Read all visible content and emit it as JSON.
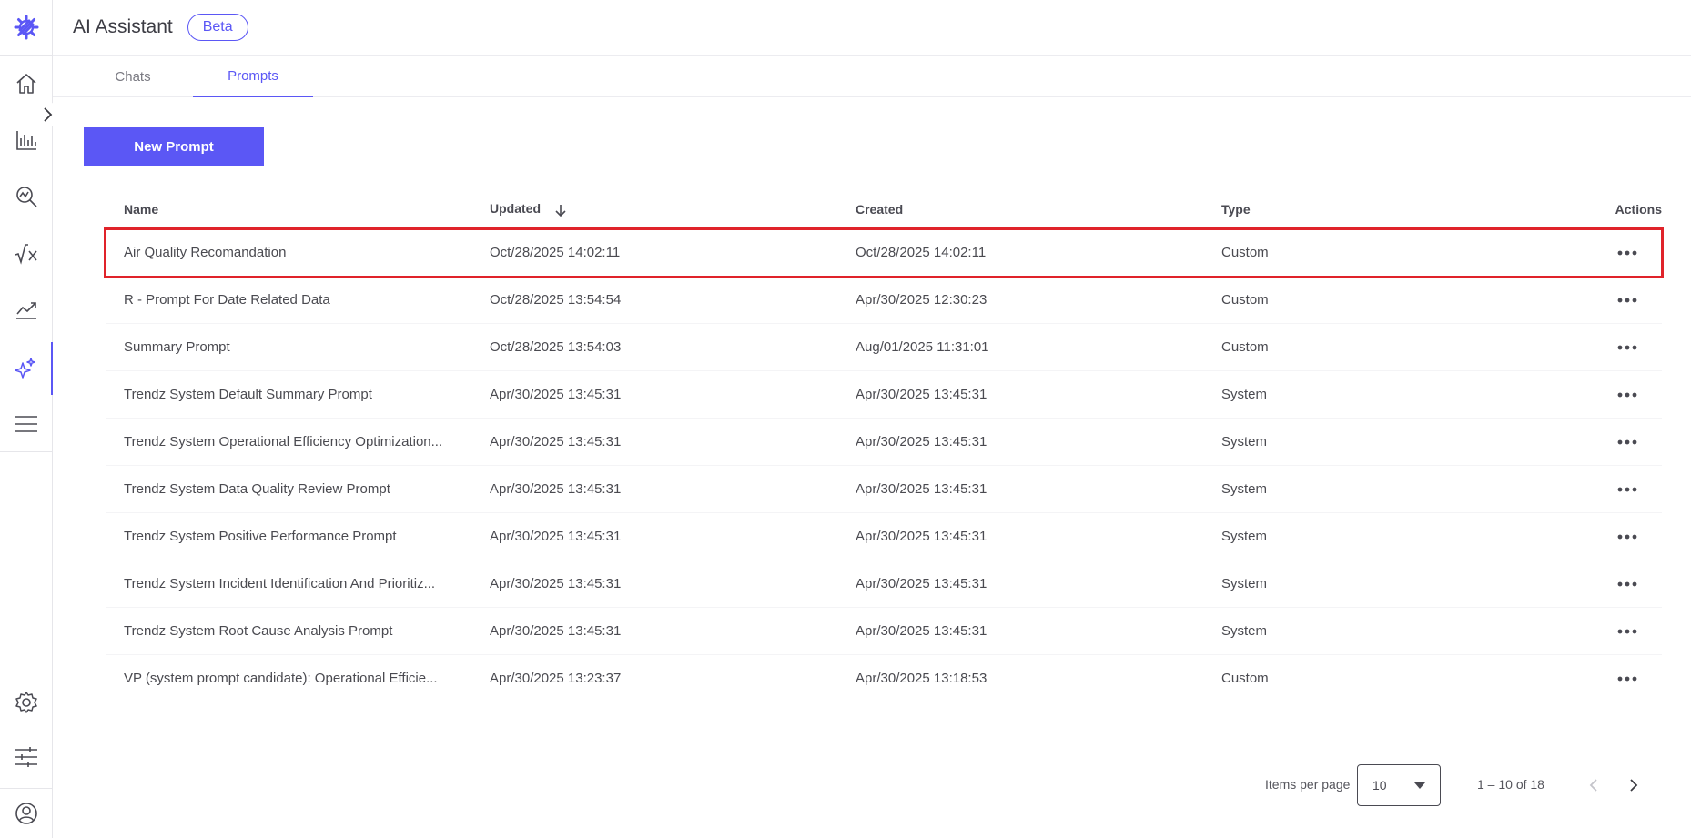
{
  "colors": {
    "accent": "#5b57f5",
    "highlight": "#e0232a",
    "sidebar_icon": "#4a4a52"
  },
  "sidebar": {
    "items": [
      {
        "name": "logo",
        "icon": "gear-logo-icon"
      },
      {
        "name": "home",
        "icon": "home-icon"
      },
      {
        "name": "analytics",
        "icon": "bar-chart-icon"
      },
      {
        "name": "search",
        "icon": "search-analytics-icon"
      },
      {
        "name": "formula",
        "icon": "sqrt-x-icon"
      },
      {
        "name": "trends",
        "icon": "line-chart-icon"
      },
      {
        "name": "ai-assistant",
        "icon": "sparkle-icon",
        "active": true
      },
      {
        "name": "menu",
        "icon": "hamburger-icon"
      },
      {
        "name": "settings",
        "icon": "settings-icon"
      },
      {
        "name": "preferences",
        "icon": "sliders-icon"
      },
      {
        "name": "profile",
        "icon": "user-icon"
      }
    ]
  },
  "header": {
    "title": "AI Assistant",
    "badge": "Beta"
  },
  "tabs": [
    {
      "label": "Chats",
      "active": false
    },
    {
      "label": "Prompts",
      "active": true
    }
  ],
  "toolbar": {
    "new_prompt_label": "New Prompt"
  },
  "table": {
    "columns": {
      "name": "Name",
      "updated": "Updated",
      "created": "Created",
      "type": "Type",
      "actions": "Actions"
    },
    "rows": [
      {
        "name": "Air Quality Recomandation",
        "updated": "Oct/28/2025 14:02:11",
        "created": "Oct/28/2025 14:02:11",
        "type": "Custom",
        "highlighted": true
      },
      {
        "name": "R - Prompt For Date Related Data",
        "updated": "Oct/28/2025 13:54:54",
        "created": "Apr/30/2025 12:30:23",
        "type": "Custom"
      },
      {
        "name": "Summary Prompt",
        "updated": "Oct/28/2025 13:54:03",
        "created": "Aug/01/2025 11:31:01",
        "type": "Custom"
      },
      {
        "name": "Trendz System Default Summary Prompt",
        "updated": "Apr/30/2025 13:45:31",
        "created": "Apr/30/2025 13:45:31",
        "type": "System"
      },
      {
        "name": "Trendz System Operational Efficiency Optimization...",
        "updated": "Apr/30/2025 13:45:31",
        "created": "Apr/30/2025 13:45:31",
        "type": "System"
      },
      {
        "name": "Trendz System Data Quality Review Prompt",
        "updated": "Apr/30/2025 13:45:31",
        "created": "Apr/30/2025 13:45:31",
        "type": "System"
      },
      {
        "name": "Trendz System Positive Performance Prompt",
        "updated": "Apr/30/2025 13:45:31",
        "created": "Apr/30/2025 13:45:31",
        "type": "System"
      },
      {
        "name": "Trendz System Incident Identification And Prioritiz...",
        "updated": "Apr/30/2025 13:45:31",
        "created": "Apr/30/2025 13:45:31",
        "type": "System"
      },
      {
        "name": "Trendz System Root Cause Analysis Prompt",
        "updated": "Apr/30/2025 13:45:31",
        "created": "Apr/30/2025 13:45:31",
        "type": "System"
      },
      {
        "name": "VP (system prompt candidate): Operational Efficie...",
        "updated": "Apr/30/2025 13:23:37",
        "created": "Apr/30/2025 13:18:53",
        "type": "Custom"
      }
    ]
  },
  "pagination": {
    "items_per_page_label": "Items per page",
    "items_per_page_value": "10",
    "range_label": "1 – 10 of 18"
  }
}
